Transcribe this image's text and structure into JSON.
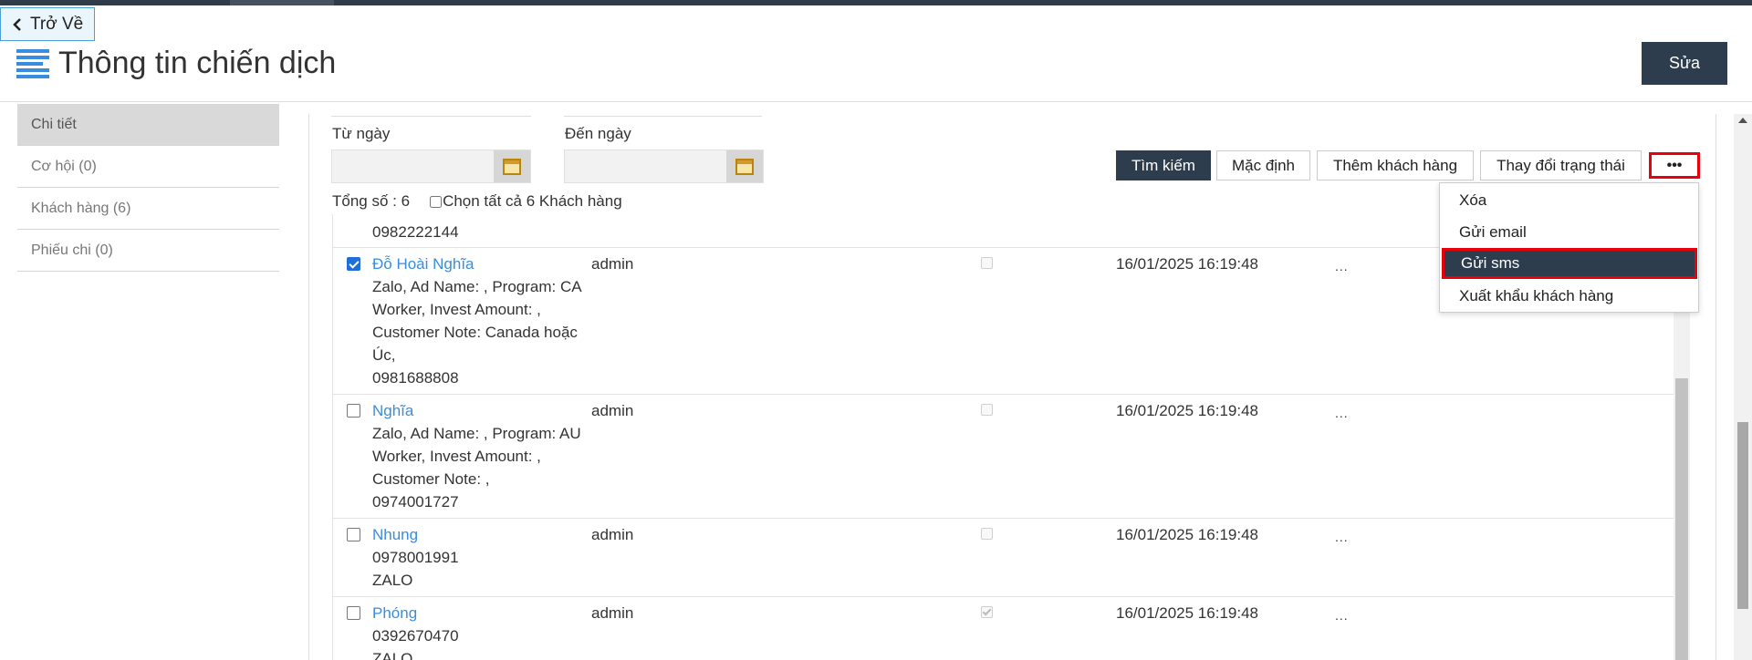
{
  "header": {
    "back_label": "Trở Về",
    "title": "Thông tin chiến dịch",
    "edit_label": "Sửa"
  },
  "sidebar": {
    "items": [
      {
        "label": "Chi tiết",
        "active": true
      },
      {
        "label": "Cơ hội (0)"
      },
      {
        "label": "Khách hàng (6)"
      },
      {
        "label": "Phiếu chi (0)"
      }
    ]
  },
  "filters": {
    "from_label": "Từ ngày",
    "to_label": "Đến ngày",
    "from_value": "",
    "to_value": ""
  },
  "toolbar": {
    "search_label": "Tìm kiếm",
    "default_label": "Mặc định",
    "add_customer_label": "Thêm khách hàng",
    "change_status_label": "Thay đổi trạng thái",
    "more_label": "•••"
  },
  "summary": {
    "total_label": "Tổng số : 6",
    "select_all_label": "Chọn tất cả 6 Khách hàng"
  },
  "dropdown": {
    "items": [
      {
        "label": "Xóa"
      },
      {
        "label": "Gửi email"
      },
      {
        "label": "Gửi sms",
        "active": true
      },
      {
        "label": "Xuất khẩu khách hàng"
      }
    ]
  },
  "table": {
    "partial_row_text": "0982222144",
    "rows": [
      {
        "name": "Đỗ Hoài Nghĩa",
        "details": [
          "Zalo, Ad Name: , Program: CA",
          "Worker, Invest Amount: ,",
          "Customer Note: Canada hoặc",
          "Úc,",
          "0981688808"
        ],
        "owner": "admin",
        "selected": true,
        "flag": false,
        "datetime": "16/01/2025 16:19:48",
        "more": "..."
      },
      {
        "name": "Nghĩa",
        "details": [
          "Zalo, Ad Name: , Program: AU",
          "Worker, Invest Amount: ,",
          "Customer Note: ,",
          "0974001727"
        ],
        "owner": "admin",
        "selected": false,
        "flag": false,
        "datetime": "16/01/2025 16:19:48",
        "more": "..."
      },
      {
        "name": "Nhung",
        "details": [
          "0978001991",
          "ZALO"
        ],
        "owner": "admin",
        "selected": false,
        "flag": false,
        "datetime": "16/01/2025 16:19:48",
        "more": "..."
      },
      {
        "name": "Phóng",
        "details": [
          "0392670470",
          "ZALO"
        ],
        "owner": "admin",
        "selected": false,
        "flag": true,
        "datetime": "16/01/2025 16:19:48",
        "more": "..."
      }
    ]
  }
}
